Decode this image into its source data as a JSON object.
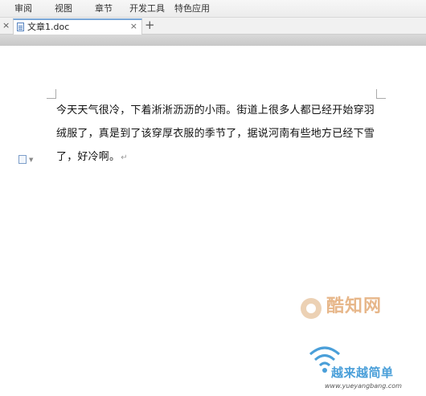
{
  "menu": {
    "items": [
      {
        "label": "审阅"
      },
      {
        "label": "视图"
      },
      {
        "label": "章节"
      },
      {
        "label": "开发工具"
      },
      {
        "label": "特色应用"
      }
    ]
  },
  "tabs": {
    "close_left": "×",
    "active_title": "文章1.doc",
    "close": "×",
    "add": "+"
  },
  "document": {
    "paragraph": "今天天气很冷，下着淅淅沥沥的小雨。街道上很多人都已经开始穿羽绒服了，真是到了该穿厚衣服的季节了，据说河南有些地方已经下雪了，好冷啊。",
    "paragraph_mark": "↵"
  },
  "watermark": {
    "logo_text": "酷知网",
    "brand_text": "越来越简单",
    "url": "www.yueyangbang.com"
  },
  "colors": {
    "tab_accent": "#7aa7d8",
    "watermark_orange": "#e7b78a",
    "watermark_blue": "#4a9fd9"
  }
}
